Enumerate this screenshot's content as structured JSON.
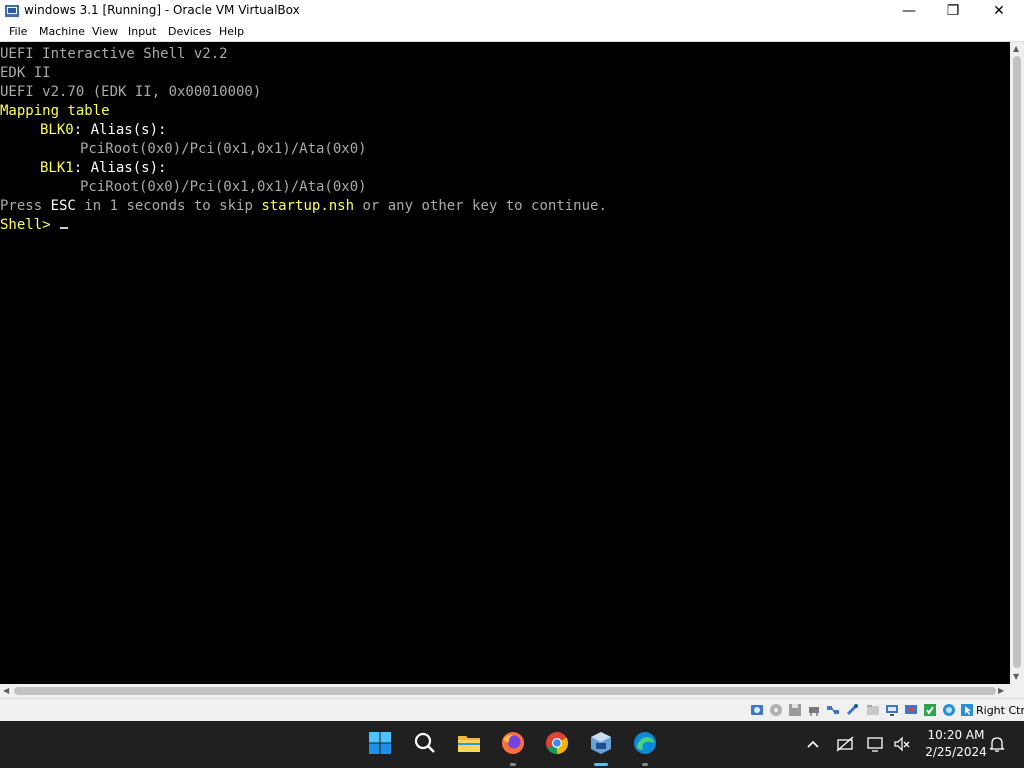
{
  "window": {
    "title": "windows 3.1 [Running] - Oracle VM VirtualBox",
    "controls": {
      "minimize": "—",
      "maximize": "❐",
      "close": "✕"
    }
  },
  "menu": [
    "File",
    "Machine",
    "View",
    "Input",
    "Devices",
    "Help"
  ],
  "console": {
    "line1": "UEFI Interactive Shell v2.2",
    "line2": "EDK II",
    "line3": "UEFI v2.70 (EDK II, 0x00010000)",
    "mapping_header": "Mapping table",
    "blk0_name": "BLK0",
    "blk0_rest": ": Alias(s):",
    "blk0_path": "PciRoot(0x0)/Pci(0x1,0x1)/Ata(0x0)",
    "blk1_name": "BLK1",
    "blk1_rest": ": Alias(s):",
    "blk1_path": "PciRoot(0x0)/Pci(0x1,0x1)/Ata(0x0)",
    "press_a": "Press ",
    "press_esc": "ESC",
    "press_b": " in 1 seconds to skip ",
    "press_startup": "startup.nsh",
    "press_c": " or any other key to continue.",
    "prompt": "Shell>"
  },
  "statusbar": {
    "icons": [
      "hard-disk-icon",
      "optical-drive-icon",
      "floppy-icon",
      "audio-icon",
      "network-icon",
      "usb-icon",
      "shared-folders-icon",
      "display-icon",
      "video-capture-icon",
      "guest-additions-icon",
      "cpu-icon",
      "mouse-integration-icon"
    ],
    "host_key": "Right Ctrl"
  },
  "taskbar": {
    "apps": [
      "windows-start-icon",
      "search-icon",
      "file-explorer-icon",
      "firefox-icon",
      "chrome-icon",
      "virtualbox-icon",
      "edge-icon"
    ],
    "tray_icons": [
      "chevron-up-icon",
      "network-off-icon",
      "display-connect-icon",
      "volume-muted-icon",
      "notification-bell-icon"
    ],
    "time": "10:20 AM",
    "date": "2/25/2024"
  },
  "colors": {
    "console_text": "#aaaaaa",
    "console_highlight": "#ffff55",
    "console_bright": "#ffffff",
    "taskbar": "#202020",
    "active_indicator": "#4cc2ff"
  }
}
